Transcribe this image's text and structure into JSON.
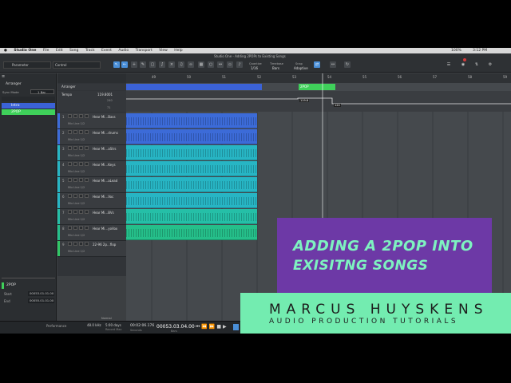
{
  "menubar": {
    "items": [
      "Studio One",
      "File",
      "Edit",
      "Song",
      "Track",
      "Event",
      "Audio",
      "Transport",
      "View",
      "Help"
    ],
    "window_title": "Studio One - Adding 2POPs to Existing Songs",
    "battery": "100%",
    "clock": "3:12 PM"
  },
  "toolbar": {
    "parameter_label": "Parameter",
    "control_label": "Control",
    "quantize_label": "Quantize",
    "quantize_value": "1/16",
    "timebase_label": "Timebase",
    "timebase_value": "Bars",
    "snap_label": "Snap",
    "snap_value": "Adaptive"
  },
  "left_panel": {
    "tab": "Arranger",
    "sync_label": "Sync Mode",
    "sync_value": "1 Bar",
    "sections": [
      {
        "name": "Intro",
        "color": "#3b62d6"
      },
      {
        "name": "2POP",
        "color": "#3fd05a"
      }
    ],
    "inspector_name": "2POP",
    "start_label": "Start",
    "start_value": "00053.01.01.00",
    "end_label": "End",
    "end_value": "00055.01.01.00"
  },
  "track_header": {
    "arranger_label": "Arranger",
    "tempo_label": "Tempo",
    "tempo_value": "119.8001",
    "scale_hi": "240",
    "scale_lo": "71"
  },
  "tracks": [
    {
      "num": "1",
      "name": "Hear Mi...Bass",
      "sub": "Mix Line 1/2",
      "color": "#3c6bd8"
    },
    {
      "num": "2",
      "name": "Hear Mi...drums",
      "sub": "Mix Line 1/2",
      "color": "#3c6bd8"
    },
    {
      "num": "3",
      "name": "Hear Mi...aStrs",
      "sub": "Mix Line 1/2",
      "color": "#27b5c4"
    },
    {
      "num": "4",
      "name": "Hear Mi...Keys",
      "sub": "Mix Line 1/2",
      "color": "#27b5c4"
    },
    {
      "num": "5",
      "name": "Hear Mi...aLead",
      "sub": "Mix Line 1/2",
      "color": "#27b5c4"
    },
    {
      "num": "6",
      "name": "Hear Mi...Voc",
      "sub": "Mix Line 1/2",
      "color": "#27b5c4"
    },
    {
      "num": "7",
      "name": "Hear Mi...BVs",
      "sub": "Mix Line 1/2",
      "color": "#25bfa7"
    },
    {
      "num": "8",
      "name": "Hear Mi...yoVox",
      "sub": "Mix Line 1/2",
      "color": "#25bf8a"
    },
    {
      "num": "9",
      "name": "22-96 2p...flop",
      "sub": "Mix Line 1/2",
      "color": "#31c766"
    }
  ],
  "timeline": {
    "ruler": [
      "49",
      "50",
      "51",
      "52",
      "53",
      "54",
      "55",
      "56",
      "57",
      "58",
      "59"
    ],
    "arranger_section": "2POP",
    "tempo_marks": [
      "119.8",
      "120"
    ],
    "pop_clip_label": "22-96 2p...flop"
  },
  "status": {
    "mode": "Performance",
    "sample_rate": "48.0 kHz",
    "length": "5:00 days",
    "record_max": "Record Max",
    "time": "00:02:06.176",
    "position": "00053.03.04.00",
    "position_label": "Bars",
    "seconds_label": "Seconds",
    "normal": "Normal"
  },
  "overlay": {
    "title_line1": "ADDING A 2POP INTO",
    "title_line2": "EXISITNG SONGS",
    "name": "MARCUS HUYSKENS",
    "subtitle": "AUDIO PRODUCTION TUTORIALS"
  },
  "colors": {
    "purple_panel": "#6d39a6",
    "mint": "#73ecb0",
    "blue_clip": "#3c6bd8",
    "cyan_clip": "#27b5c4",
    "green_clip": "#31c766"
  }
}
